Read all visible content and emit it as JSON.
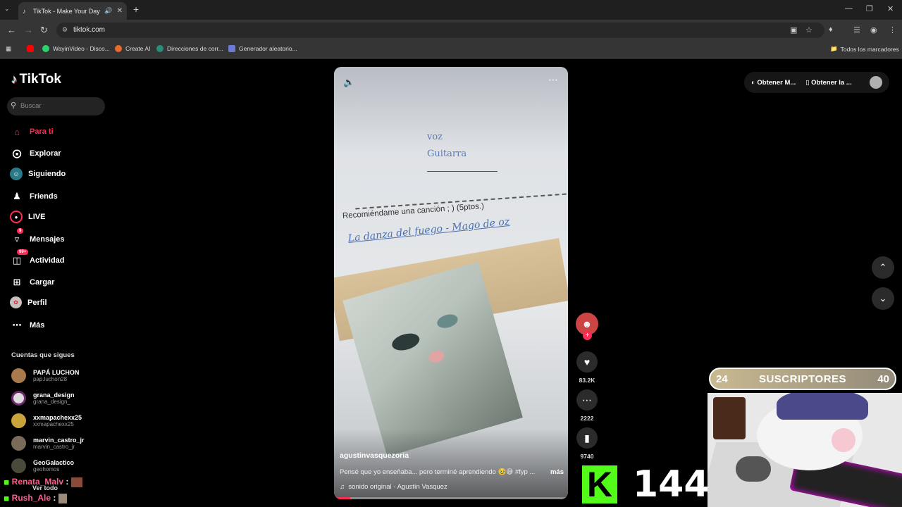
{
  "browser": {
    "tab_title": "TikTok - Make Your Day",
    "url": "tiktok.com",
    "bookmarks": [
      "WayinVideo - Disco...",
      "Create AI",
      "Direcciones de corr...",
      "Generador aleatorio..."
    ],
    "all_bookmarks": "Todos los marcadores"
  },
  "brand": "TikTok",
  "search_placeholder": "Buscar",
  "nav": [
    "Para ti",
    "Explorar",
    "Siguiendo",
    "Friends",
    "LIVE",
    "Mensajes",
    "Actividad",
    "Cargar",
    "Perfil",
    "Más"
  ],
  "nav_badges": {
    "mensajes": "9",
    "actividad": "99+"
  },
  "following_title": "Cuentas que sigues",
  "following": [
    {
      "name": "PAPÁ LUCHON",
      "handle": "pap.luchon28"
    },
    {
      "name": "grana_design",
      "handle": "grana_design_"
    },
    {
      "name": "xxmapachexx25",
      "handle": "xxmapachexx25"
    },
    {
      "name": "marvin_castro_jr",
      "handle": "marvin_castro_jr"
    },
    {
      "name": "GeoGalactico",
      "handle": "geohomos"
    }
  ],
  "see_all": "Ver todo",
  "chat": [
    {
      "user": "Renata_Malv",
      "sep": ":"
    },
    {
      "user": "Rush_Ale",
      "sep": ":"
    }
  ],
  "video": {
    "paper_lines": [
      "voz",
      "Guitarra",
      "Recomiéndame una canción ; )  (5ptos.)",
      "La danza del fuego - Mago de oz"
    ],
    "username": "agustinvasquezoria",
    "caption": "Pensé que yo enseñaba... pero terminé aprendiendo 🥹😅 #fyp ...",
    "more": "más",
    "sound": "sonido original - Agustín Vasquez",
    "progress": 0.07
  },
  "actions": {
    "likes": "83.2K",
    "comments": "2222",
    "saves": "9740"
  },
  "topright": {
    "coins": "Obtener M...",
    "app": "Obtener la ..."
  },
  "overlay": {
    "subs_current": "24",
    "subs_label": "SUSCRIPTORES",
    "subs_goal": "40",
    "kick_count": "144"
  }
}
